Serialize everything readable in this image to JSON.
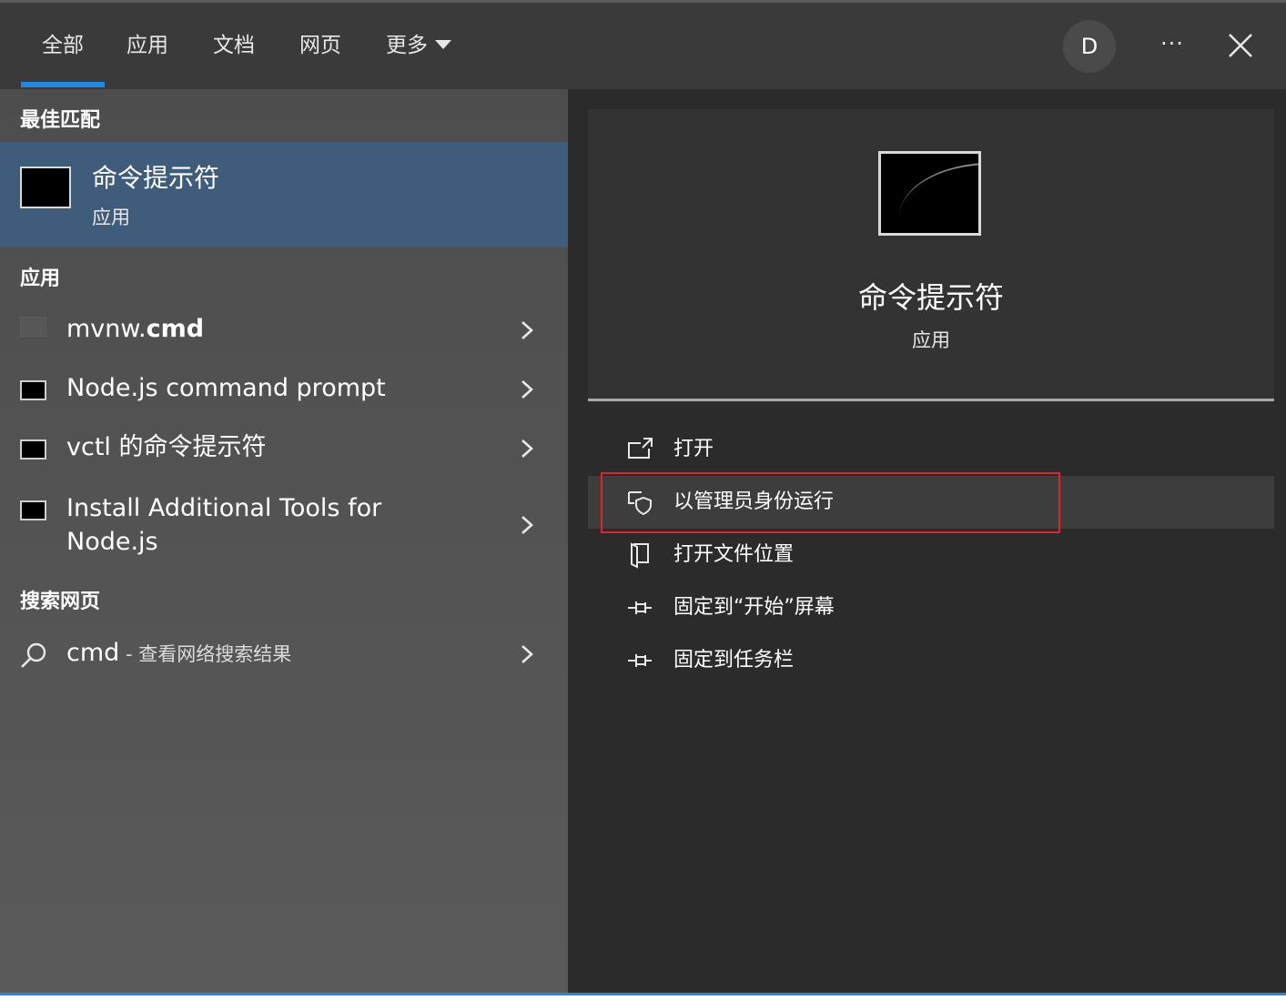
{
  "tabs": [
    {
      "label": "全部",
      "active": true
    },
    {
      "label": "应用",
      "active": false
    },
    {
      "label": "文档",
      "active": false
    },
    {
      "label": "网页",
      "active": false
    },
    {
      "label": "更多",
      "active": false
    }
  ],
  "header": {
    "avatar_letter": "D",
    "more_label": "···"
  },
  "left": {
    "best_match_header": "最佳匹配",
    "best_match": {
      "title": "命令提示符",
      "subtitle": "应用",
      "icon": "terminal-icon"
    },
    "apps_header": "应用",
    "apps": [
      {
        "prefix": "mvnw.",
        "bold": "cmd",
        "icon": "blank-icon"
      },
      {
        "prefix": "Node.js command prompt",
        "bold": "",
        "icon": "terminal-icon"
      },
      {
        "prefix": "vctl 的命令提示符",
        "bold": "",
        "icon": "terminal-icon"
      },
      {
        "line1": "Install Additional Tools for",
        "line2": "Node.js",
        "icon": "terminal-icon"
      }
    ],
    "web_header": "搜索网页",
    "web_search": {
      "query": "cmd",
      "suffix": " - 查看网络搜索结果",
      "icon": "search-icon"
    }
  },
  "right": {
    "title": "命令提示符",
    "subtitle": "应用",
    "actions": [
      {
        "label": "打开",
        "icon": "open-icon"
      },
      {
        "label": "以管理员身份运行",
        "icon": "shield-icon",
        "highlighted": true
      },
      {
        "label": "打开文件位置",
        "icon": "folder-icon"
      },
      {
        "label": "固定到“开始”屏幕",
        "icon": "pin-icon"
      },
      {
        "label": "固定到任务栏",
        "icon": "pin-icon"
      }
    ]
  },
  "colors": {
    "accent": "#1e88e5",
    "selection": "#3f5d7b",
    "highlight_box": "#e0242a"
  }
}
